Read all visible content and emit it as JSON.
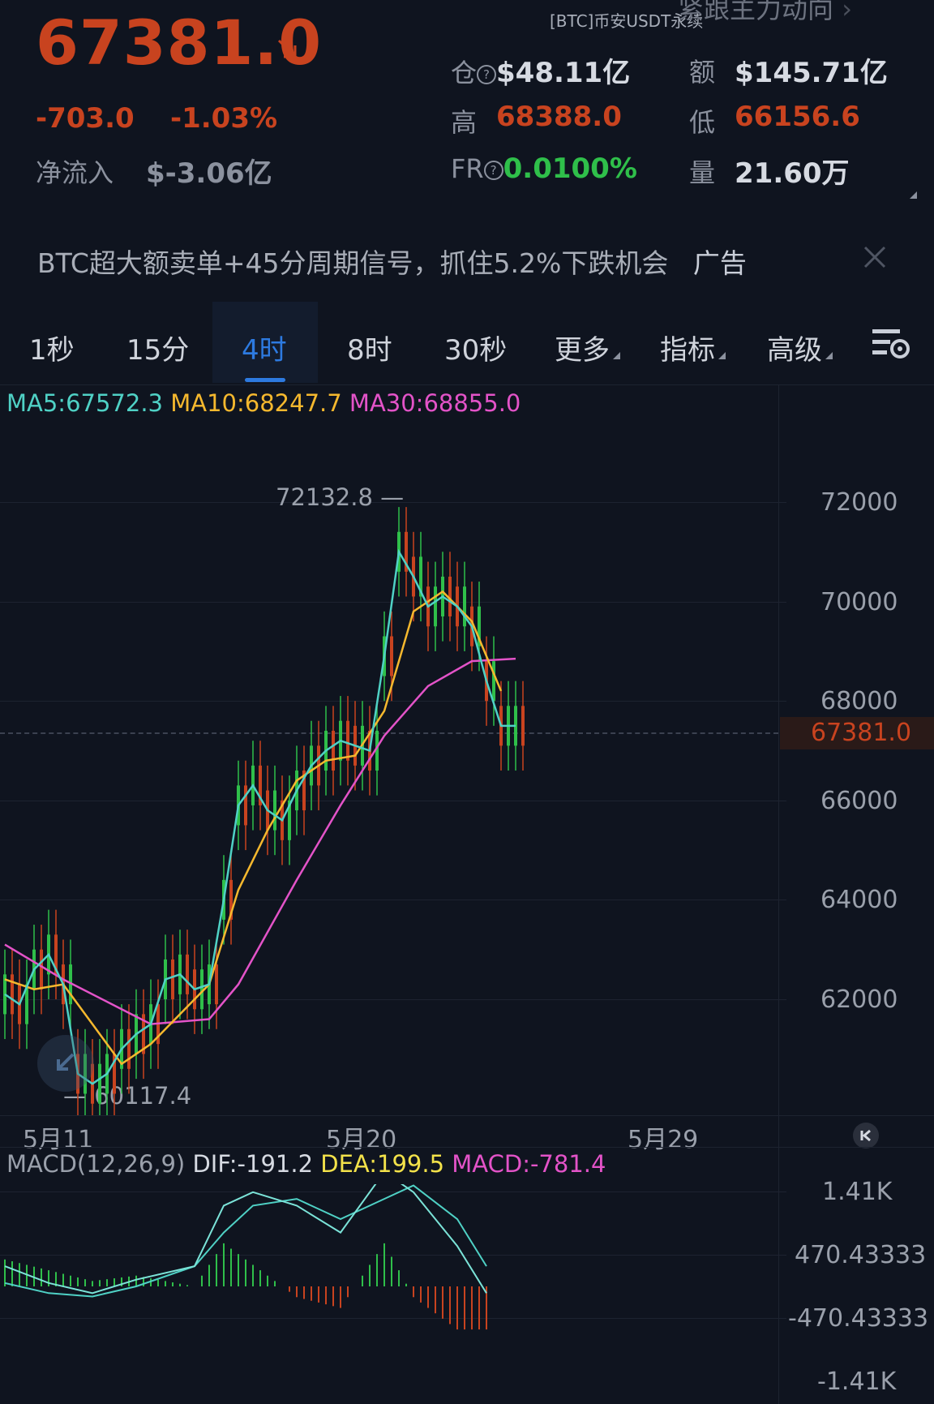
{
  "header": {
    "symbol": "[BTC]币安USDT永续",
    "follow_label": "紧跟主力动向",
    "last_price": "67381.0",
    "change_abs": "-703.0",
    "change_pct": "-1.03%",
    "netflow_label": "净流入",
    "netflow_value": "$-3.06亿",
    "oi_label": "仓",
    "oi_value": "$48.11亿",
    "amount_label": "额",
    "amount_value": "$145.71亿",
    "high_label": "高",
    "high_value": "68388.0",
    "low_label": "低",
    "low_value": "66156.6",
    "fr_label": "FR",
    "fr_value": "0.0100%",
    "vol_label": "量",
    "vol_value": "21.60万"
  },
  "ad": {
    "text": "BTC超大额卖单+45分周期信号，抓住5.2%下跌机会",
    "tag": "广告"
  },
  "tabs": [
    "1秒",
    "15分",
    "4时",
    "8时",
    "30秒",
    "更多",
    "指标",
    "高级"
  ],
  "active_tab": "4时",
  "ma_legend": {
    "ma5": "MA5:67572.3",
    "ma10": "MA10:68247.7",
    "ma30": "MA30:68855.0"
  },
  "price_axis": [
    "72000",
    "70000",
    "68000",
    "66000",
    "64000",
    "62000"
  ],
  "current_price_tag": "67381.0",
  "annotations": {
    "high": "72132.8",
    "low": "60117.4"
  },
  "date_axis": [
    "5月11",
    "5月20",
    "5月29"
  ],
  "macd_legend": {
    "name": "MACD(12,26,9)",
    "dif": "DIF:-191.2",
    "dea": "DEA:199.5",
    "macd": "MACD:-781.4"
  },
  "macd_axis": [
    "1.41K",
    "470.43333",
    "-470.43333",
    "-1.41K"
  ],
  "colors": {
    "up": "#2fbf4a",
    "down": "#c8431f",
    "ma5": "#4fd1c5",
    "ma10": "#f5b82e",
    "ma30": "#e353c8",
    "accent": "#2d7ae0"
  },
  "chart_data": {
    "type": "candlestick",
    "ylim": [
      60000,
      73500
    ],
    "last_price": 67381.0,
    "ma5_path": [
      [
        0,
        62100
      ],
      [
        1,
        61900
      ],
      [
        2,
        62600
      ],
      [
        3,
        62900
      ],
      [
        4,
        62300
      ],
      [
        5,
        60500
      ],
      [
        6,
        60300
      ],
      [
        7,
        60500
      ],
      [
        8,
        61000
      ],
      [
        9,
        61300
      ],
      [
        10,
        61500
      ],
      [
        11,
        62400
      ],
      [
        12,
        62500
      ],
      [
        13,
        62200
      ],
      [
        14,
        62300
      ],
      [
        15,
        64000
      ],
      [
        16,
        65900
      ],
      [
        17,
        66300
      ],
      [
        18,
        65800
      ],
      [
        19,
        65600
      ],
      [
        20,
        66200
      ],
      [
        21,
        66700
      ],
      [
        22,
        67000
      ],
      [
        23,
        67200
      ],
      [
        24,
        67100
      ],
      [
        25,
        67000
      ],
      [
        26,
        68900
      ],
      [
        27,
        71000
      ],
      [
        28,
        70500
      ],
      [
        29,
        69900
      ],
      [
        30,
        70100
      ],
      [
        31,
        69900
      ],
      [
        32,
        69500
      ],
      [
        33,
        68400
      ],
      [
        34,
        67500
      ],
      [
        35,
        67500
      ]
    ],
    "ma10_path": [
      [
        0,
        62400
      ],
      [
        2,
        62200
      ],
      [
        4,
        62300
      ],
      [
        6,
        61500
      ],
      [
        8,
        60700
      ],
      [
        10,
        61100
      ],
      [
        12,
        61700
      ],
      [
        14,
        62300
      ],
      [
        16,
        64200
      ],
      [
        18,
        65400
      ],
      [
        20,
        66400
      ],
      [
        22,
        66800
      ],
      [
        24,
        66900
      ],
      [
        26,
        67800
      ],
      [
        28,
        69800
      ],
      [
        30,
        70200
      ],
      [
        32,
        69600
      ],
      [
        34,
        68200
      ]
    ],
    "ma30_path": [
      [
        0,
        63100
      ],
      [
        4,
        62400
      ],
      [
        8,
        61800
      ],
      [
        10,
        61500
      ],
      [
        14,
        61600
      ],
      [
        16,
        62300
      ],
      [
        20,
        64400
      ],
      [
        23,
        65900
      ],
      [
        26,
        67300
      ],
      [
        29,
        68300
      ],
      [
        32,
        68800
      ],
      [
        35,
        68850
      ]
    ],
    "macd_dif_path": [
      [
        0,
        0.3
      ],
      [
        3,
        0.05
      ],
      [
        6,
        -0.1
      ],
      [
        9,
        0.1
      ],
      [
        13,
        0.3
      ],
      [
        15,
        1.2
      ],
      [
        17,
        1.4
      ],
      [
        20,
        1.2
      ],
      [
        23,
        0.8
      ],
      [
        26,
        1.7
      ],
      [
        28,
        1.4
      ],
      [
        31,
        0.6
      ],
      [
        33,
        -0.1
      ]
    ],
    "macd_dea_path": [
      [
        0,
        0.05
      ],
      [
        3,
        -0.1
      ],
      [
        6,
        -0.15
      ],
      [
        9,
        0.0
      ],
      [
        13,
        0.3
      ],
      [
        15,
        0.8
      ],
      [
        17,
        1.2
      ],
      [
        20,
        1.3
      ],
      [
        23,
        1.0
      ],
      [
        26,
        1.3
      ],
      [
        28,
        1.5
      ],
      [
        31,
        1.0
      ],
      [
        33,
        0.3
      ]
    ]
  }
}
